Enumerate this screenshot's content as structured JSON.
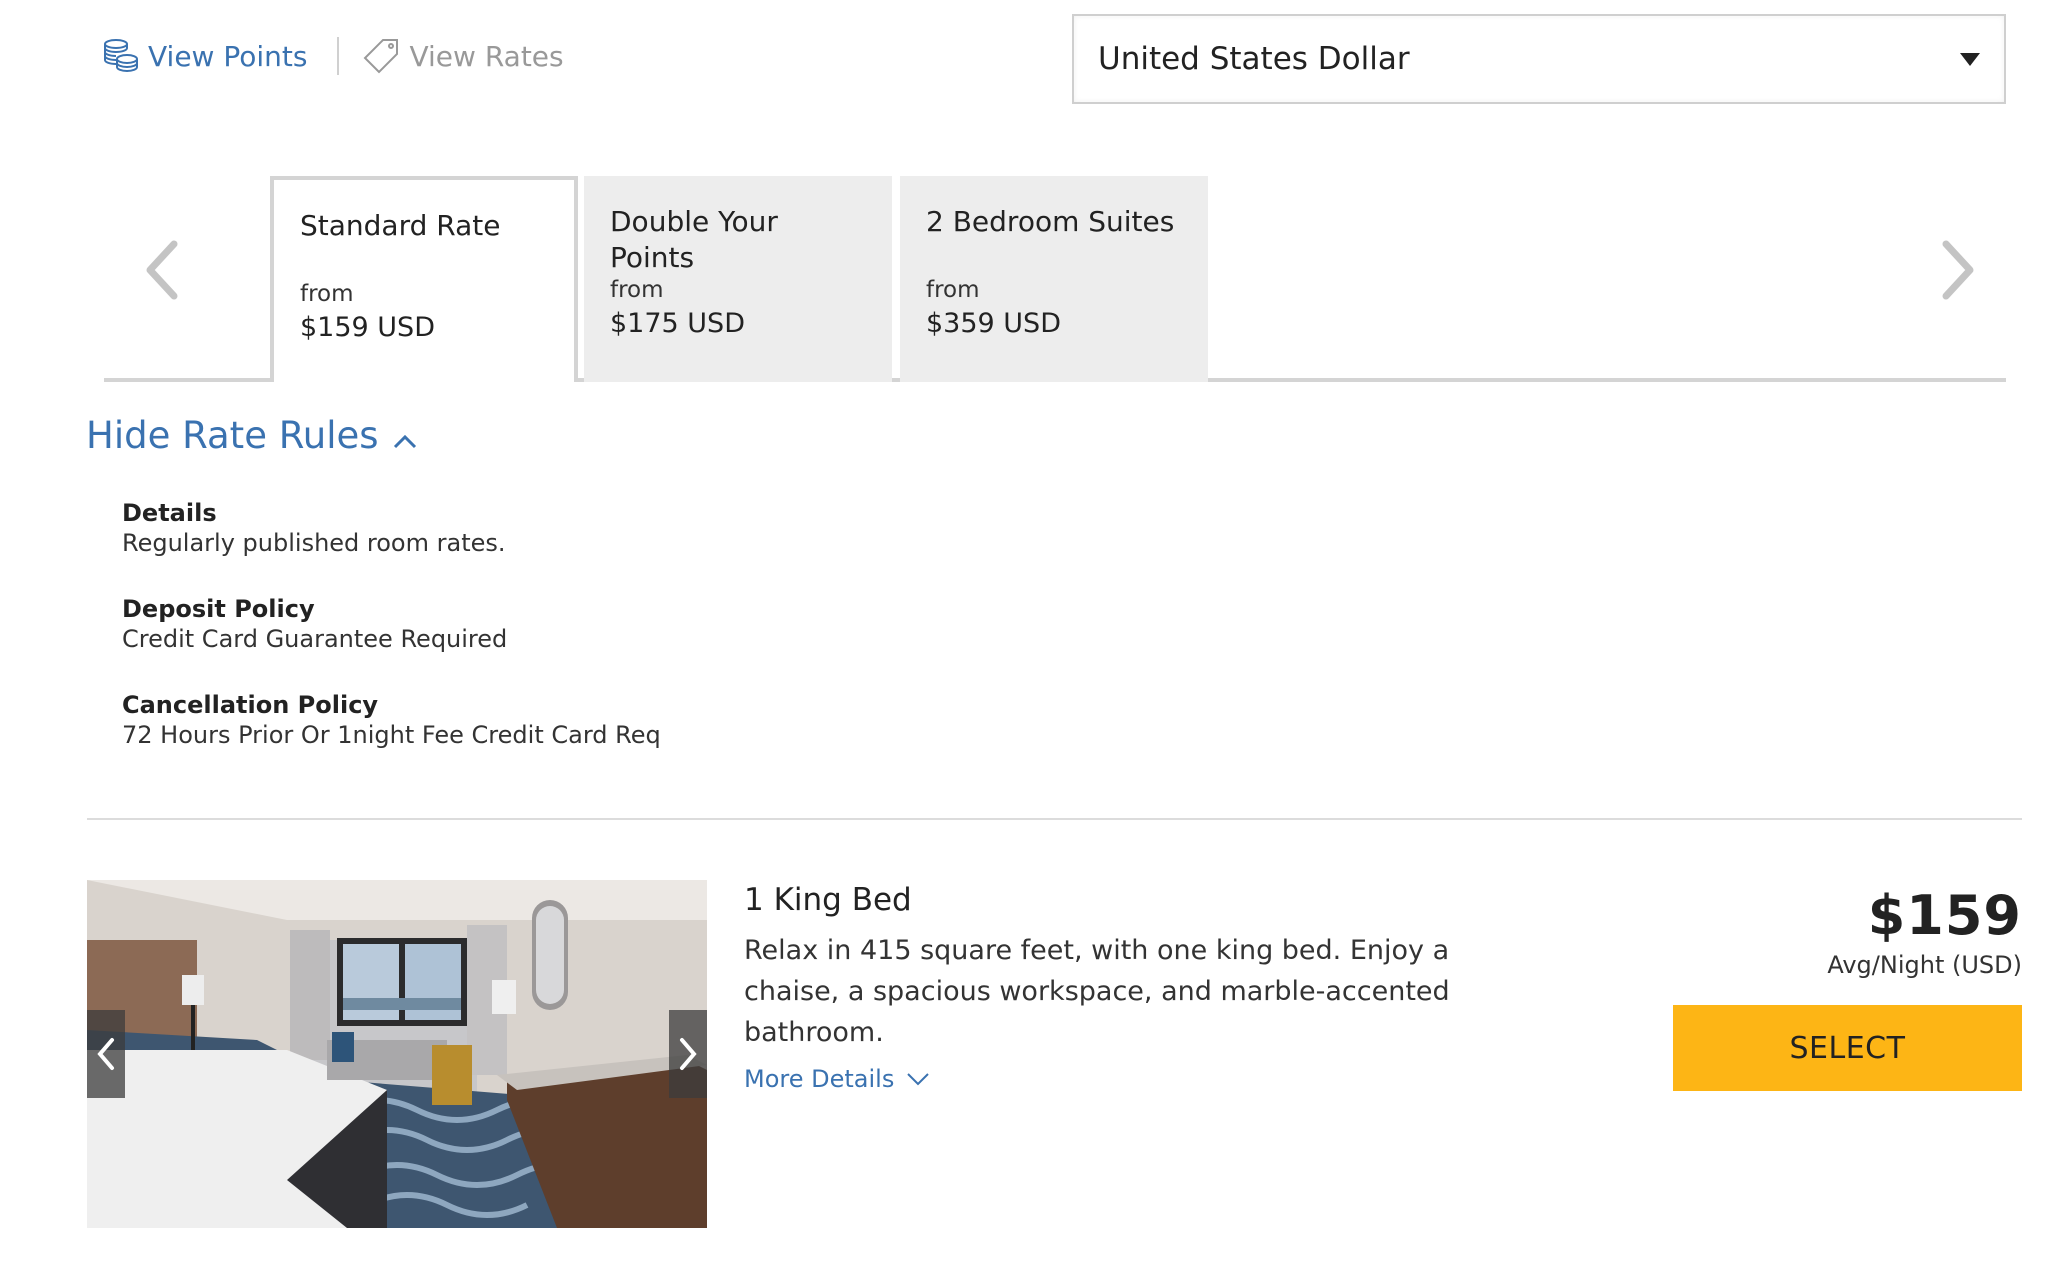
{
  "view_toggle": {
    "points_label": "View Points",
    "points_icon": "coins-stack-icon",
    "rates_label": "View Rates",
    "rates_icon": "price-tag-icon",
    "active": "points"
  },
  "currency": {
    "selected": "United States Dollar",
    "icon": "caret-down-icon"
  },
  "rate_tabs": {
    "prev_icon": "chevron-left-icon",
    "next_icon": "chevron-right-icon",
    "items": [
      {
        "name": "Standard Rate",
        "from_label": "from",
        "price": "$159 USD",
        "active": true
      },
      {
        "name": "Double Your Points",
        "from_label": "from",
        "price": "$175 USD",
        "active": false
      },
      {
        "name": "2 Bedroom Suites",
        "from_label": "from",
        "price": "$359 USD",
        "active": false
      }
    ]
  },
  "rate_rules": {
    "toggle_label": "Hide Rate Rules",
    "toggle_icon": "chevron-up-icon",
    "rules": [
      {
        "title": "Details",
        "value": "Regularly published room rates."
      },
      {
        "title": "Deposit Policy",
        "value": "Credit Card Guarantee Required"
      },
      {
        "title": "Cancellation Policy",
        "value": "72 Hours Prior Or 1night Fee Credit Card Req"
      }
    ]
  },
  "room": {
    "photo_alt": "Hotel room with king bed, chaise, desk and city window view",
    "name": "1 King Bed",
    "description": "Relax in 415 square feet, with one king bed. Enjoy a chaise, a spacious workspace, and marble-accented bathroom.",
    "more_details_label": "More Details",
    "price": "$159",
    "price_unit": "Avg/Night (USD)",
    "select_label": "SELECT"
  },
  "colors": {
    "link_blue": "#3a72b0",
    "select_yellow": "#fdb515",
    "tab_inactive_bg": "#ededed",
    "border_gray": "#d4d4d4"
  }
}
